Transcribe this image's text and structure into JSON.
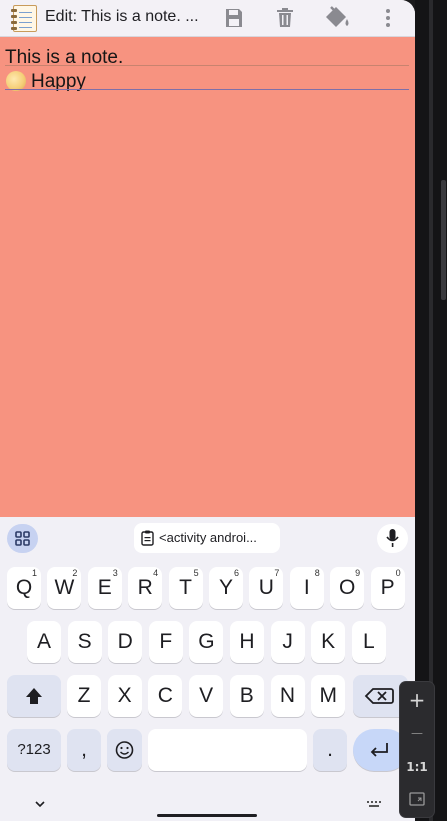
{
  "app_bar": {
    "title": "Edit: This is a note. ...",
    "icons": [
      "notepad-app-icon",
      "save-icon",
      "delete-icon",
      "paint-bucket-icon",
      "more-vert-icon"
    ]
  },
  "note": {
    "background": "#f79380",
    "lines": [
      "This is a note.",
      "Happy"
    ],
    "emoji_icon": "moon-emoji-icon"
  },
  "keyboard": {
    "toolbar": {
      "clipboard_suggestion": "<activity androi..."
    },
    "row1": [
      {
        "label": "Q",
        "sup": "1"
      },
      {
        "label": "W",
        "sup": "2"
      },
      {
        "label": "E",
        "sup": "3"
      },
      {
        "label": "R",
        "sup": "4"
      },
      {
        "label": "T",
        "sup": "5"
      },
      {
        "label": "Y",
        "sup": "6"
      },
      {
        "label": "U",
        "sup": "7"
      },
      {
        "label": "I",
        "sup": "8"
      },
      {
        "label": "O",
        "sup": "9"
      },
      {
        "label": "P",
        "sup": "0"
      }
    ],
    "row2": [
      "A",
      "S",
      "D",
      "F",
      "G",
      "H",
      "J",
      "K",
      "L"
    ],
    "row3": [
      "Z",
      "X",
      "C",
      "V",
      "B",
      "N",
      "M"
    ],
    "symbols_label": "?123",
    "comma_label": ",",
    "period_label": ".",
    "accent_color": "#c7d7f8"
  },
  "side_panel": {
    "zoom_label": "1:1",
    "plus": "+",
    "minus": "—"
  }
}
